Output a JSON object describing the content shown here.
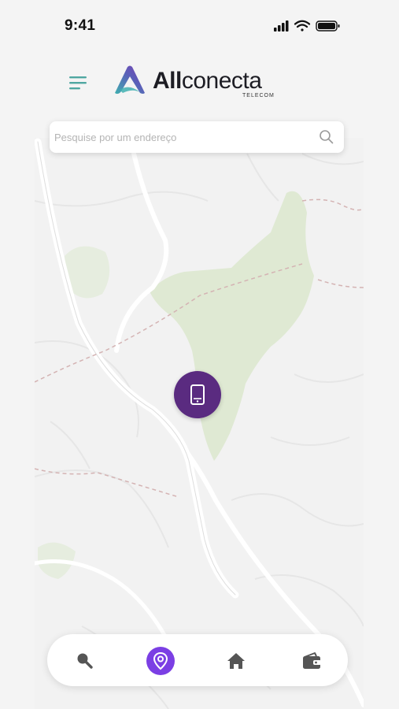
{
  "status_bar": {
    "time": "9:41"
  },
  "header": {
    "logo_bold": "All",
    "logo_regular": "conecta",
    "logo_sub": "TELECOM"
  },
  "search": {
    "placeholder": "Pesquise por um endereço"
  },
  "colors": {
    "brand_purple": "#5a2b80",
    "accent_purple": "#7b3fe4",
    "menu_teal": "#4fa7a1",
    "park_green": "#dfe9d3"
  },
  "map": {
    "marker_icon": "tablet-icon"
  },
  "bottom_nav": {
    "items": [
      {
        "icon": "search-icon",
        "active": false
      },
      {
        "icon": "location-pin-icon",
        "active": true
      },
      {
        "icon": "home-icon",
        "active": false
      },
      {
        "icon": "wallet-icon",
        "active": false
      }
    ]
  }
}
